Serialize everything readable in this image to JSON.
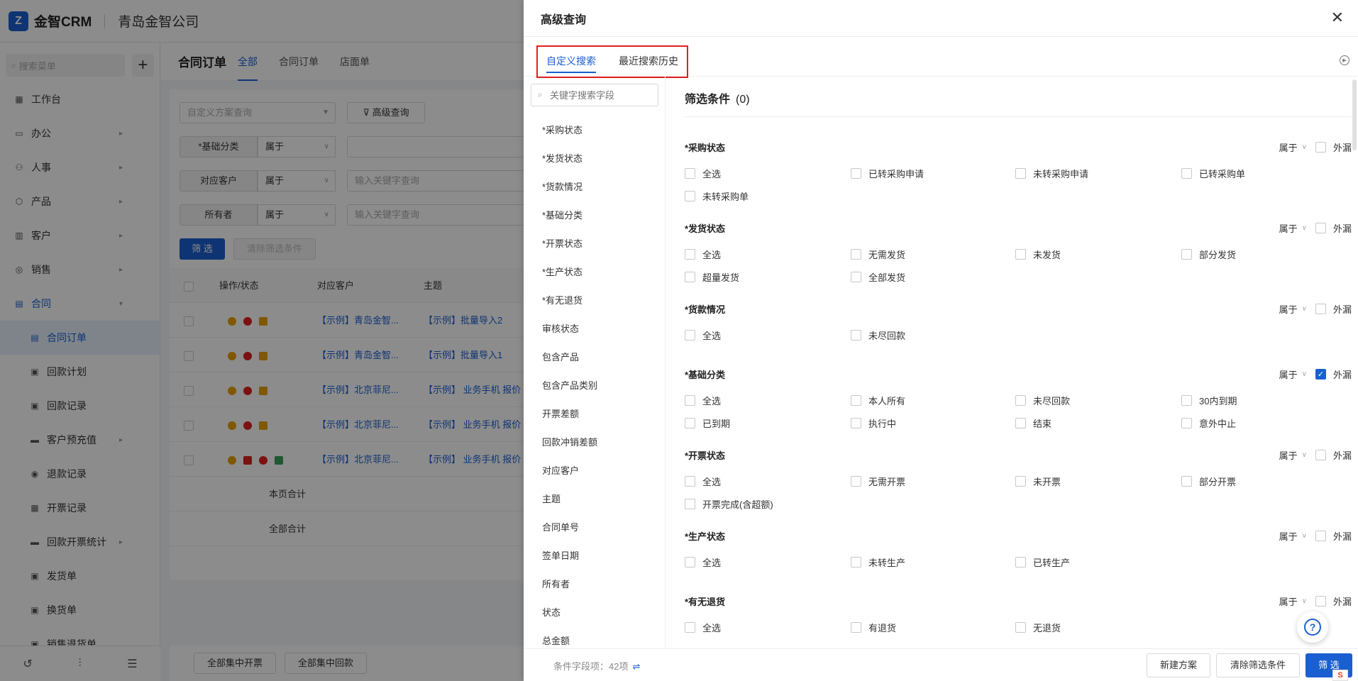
{
  "app": {
    "logo_glyph": "Z",
    "name": "金智CRM",
    "company": "青岛金智公司"
  },
  "sidebar": {
    "search_placeholder": "搜索菜单",
    "add_glyph": "+",
    "items": [
      {
        "label": "工作台",
        "icon": "dashboard-icon",
        "glyph": "▦"
      },
      {
        "label": "办公",
        "icon": "monitor-icon",
        "glyph": "▭",
        "arrow": "▸"
      },
      {
        "label": "人事",
        "icon": "people-icon",
        "glyph": "⚇",
        "arrow": "▸"
      },
      {
        "label": "产品",
        "icon": "cube-icon",
        "glyph": "⬡",
        "arrow": "▸"
      },
      {
        "label": "客户",
        "icon": "chart-icon",
        "glyph": "▥",
        "arrow": "▸"
      },
      {
        "label": "销售",
        "icon": "sales-icon",
        "glyph": "◎",
        "arrow": "▸"
      },
      {
        "label": "合同",
        "icon": "contract-icon",
        "glyph": "▤",
        "arrow": "▾"
      }
    ],
    "sub_items": [
      {
        "label": "合同订单",
        "glyph": "▤"
      },
      {
        "label": "回款计划",
        "glyph": "▣"
      },
      {
        "label": "回款记录",
        "glyph": "▣"
      },
      {
        "label": "客户预充值",
        "glyph": "▬",
        "arrow": "▸"
      },
      {
        "label": "退款记录",
        "glyph": "◉"
      },
      {
        "label": "开票记录",
        "glyph": "▦"
      },
      {
        "label": "回款开票统计",
        "glyph": "▬",
        "arrow": "▸"
      },
      {
        "label": "发货单",
        "glyph": "▣"
      },
      {
        "label": "换货单",
        "glyph": "▣"
      },
      {
        "label": "销售退货单",
        "glyph": "▣"
      }
    ],
    "bottom_icons": [
      "↺",
      "⫶",
      "☰"
    ]
  },
  "main": {
    "title": "合同订单",
    "tabs": [
      "全部",
      "合同订单",
      "店面单"
    ],
    "scheme_placeholder": "自定义方案查询",
    "advanced_query": "高级查询",
    "filters": [
      {
        "label": "*基础分类",
        "op": "属于",
        "placeholder": ""
      },
      {
        "label": "对应客户",
        "op": "属于",
        "placeholder": "输入关键字查询"
      },
      {
        "label": "所有者",
        "op": "属于",
        "placeholder": "输入关键字查询"
      }
    ],
    "filter_btn": "筛 选",
    "clear_btn": "清除筛选条件",
    "table_headers": [
      "操作/状态",
      "对应客户",
      "主题"
    ],
    "rows": [
      {
        "customer": "【示例】青岛金智...",
        "subject": "【示例】批量导入2"
      },
      {
        "customer": "【示例】青岛金智...",
        "subject": "【示例】批量导入1"
      },
      {
        "customer": "【示例】北京菲尼...",
        "subject": "【示例】 业务手机 报价"
      },
      {
        "customer": "【示例】北京菲尼...",
        "subject": "【示例】 业务手机 报价"
      },
      {
        "customer": "【示例】北京菲尼...",
        "subject": "【示例】 业务手机 报价"
      }
    ],
    "page_total": "本页合计",
    "all_total": "全部合计",
    "bulk_invoice": "全部集中开票",
    "bulk_payment": "全部集中回款"
  },
  "drawer": {
    "title": "高级查询",
    "close_glyph": "✕",
    "tabs": [
      "自定义搜索",
      "最近搜索历史"
    ],
    "tab_icon_glyph": "▶",
    "field_search_placeholder": "关键字搜索字段",
    "fields": [
      "*采购状态",
      "*发货状态",
      "*货款情况",
      "*基础分类",
      "*开票状态",
      "*生产状态",
      "*有无退货",
      "审核状态",
      "包含产品",
      "包含产品类别",
      "开票差额",
      "回款冲销差额",
      "对应客户",
      "主题",
      "合同单号",
      "签单日期",
      "所有者",
      "状态",
      "总金额"
    ],
    "conditions_title": "筛选条件",
    "conditions_count": "(0)",
    "belong_label": "属于",
    "dropdown_glyph": "∨",
    "exclude_label": "外漏",
    "check_glyph": "✓",
    "groups": [
      {
        "title": "*采购状态",
        "exclude": false,
        "options": [
          "全选",
          "已转采购申请",
          "未转采购申请",
          "已转采购单",
          "未转采购单"
        ]
      },
      {
        "title": "*发货状态",
        "exclude": false,
        "options": [
          "全选",
          "无需发货",
          "未发货",
          "部分发货",
          "超量发货",
          "全部发货"
        ]
      },
      {
        "title": "*货款情况",
        "exclude": false,
        "options": [
          "全选",
          "未尽回款"
        ]
      },
      {
        "title": "*基础分类",
        "exclude": true,
        "options": [
          "全选",
          "本人所有",
          "未尽回款",
          "30内到期",
          "已到期",
          "执行中",
          "结束",
          "意外中止"
        ]
      },
      {
        "title": "*开票状态",
        "exclude": false,
        "options": [
          "全选",
          "无需开票",
          "未开票",
          "部分开票",
          "开票完成(含超额)"
        ]
      },
      {
        "title": "*生产状态",
        "exclude": false,
        "options": [
          "全选",
          "未转生产",
          "已转生产"
        ]
      },
      {
        "title": "*有无退货",
        "exclude": false,
        "options": [
          "全选",
          "有退货",
          "无退货"
        ]
      }
    ],
    "footer_info": "条件字段项：42项",
    "footer_info_glyph": "⇌",
    "new_scheme": "新建方案",
    "clear_conditions": "清除筛选条件",
    "submit": "筛 选"
  },
  "help": {
    "glyph": "?"
  },
  "corner_badge": {
    "glyph": "S"
  },
  "colors": {
    "primary": "#1a5fd1",
    "highlight_box": "#e02020"
  }
}
